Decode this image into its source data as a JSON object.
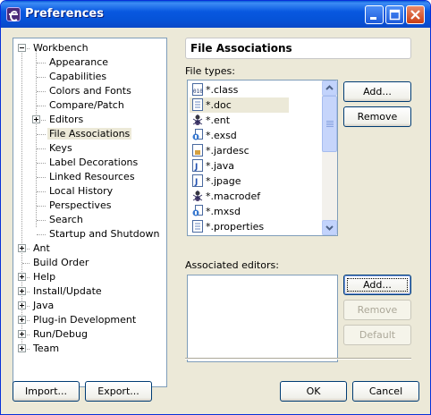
{
  "window": {
    "title": "Preferences"
  },
  "tree": {
    "items": [
      {
        "label": "Workbench",
        "level": 0,
        "expander": "minus"
      },
      {
        "label": "Appearance",
        "level": 1
      },
      {
        "label": "Capabilities",
        "level": 1
      },
      {
        "label": "Colors and Fonts",
        "level": 1
      },
      {
        "label": "Compare/Patch",
        "level": 1
      },
      {
        "label": "Editors",
        "level": 1,
        "expander": "plus"
      },
      {
        "label": "File Associations",
        "level": 1,
        "selected": true
      },
      {
        "label": "Keys",
        "level": 1
      },
      {
        "label": "Label Decorations",
        "level": 1
      },
      {
        "label": "Linked Resources",
        "level": 1
      },
      {
        "label": "Local History",
        "level": 1
      },
      {
        "label": "Perspectives",
        "level": 1
      },
      {
        "label": "Search",
        "level": 1
      },
      {
        "label": "Startup and Shutdown",
        "level": 1
      },
      {
        "label": "Ant",
        "level": 0,
        "expander": "plus"
      },
      {
        "label": "Build Order",
        "level": 0
      },
      {
        "label": "Help",
        "level": 0,
        "expander": "plus"
      },
      {
        "label": "Install/Update",
        "level": 0,
        "expander": "plus"
      },
      {
        "label": "Java",
        "level": 0,
        "expander": "plus"
      },
      {
        "label": "Plug-in Development",
        "level": 0,
        "expander": "plus"
      },
      {
        "label": "Run/Debug",
        "level": 0,
        "expander": "plus"
      },
      {
        "label": "Team",
        "level": 0,
        "expander": "plus"
      }
    ]
  },
  "page": {
    "title": "File Associations",
    "file_types_label": "File types:",
    "associated_editors_label": "Associated editors:"
  },
  "file_types": [
    {
      "label": "*.class",
      "icon": "binary-file-icon"
    },
    {
      "label": "*.doc",
      "icon": "text-file-icon",
      "selected": true
    },
    {
      "label": "*.ent",
      "icon": "ant-icon"
    },
    {
      "label": "*.exsd",
      "icon": "schema-file-icon"
    },
    {
      "label": "*.jardesc",
      "icon": "jar-file-icon"
    },
    {
      "label": "*.java",
      "icon": "java-file-icon"
    },
    {
      "label": "*.jpage",
      "icon": "java-file-icon"
    },
    {
      "label": "*.macrodef",
      "icon": "ant-icon"
    },
    {
      "label": "*.mxsd",
      "icon": "schema-file-icon"
    },
    {
      "label": "*.properties",
      "icon": "text-file-icon"
    }
  ],
  "buttons": {
    "file_add": "Add...",
    "file_remove": "Remove",
    "editor_add": "Add...",
    "editor_remove": "Remove",
    "editor_default": "Default",
    "import": "Import...",
    "export": "Export...",
    "ok": "OK",
    "cancel": "Cancel"
  },
  "colors": {
    "titlebar": "#0858e0",
    "window_bg": "#ece9d8",
    "selection": "#ece9d8",
    "close_button": "#c93e14"
  }
}
